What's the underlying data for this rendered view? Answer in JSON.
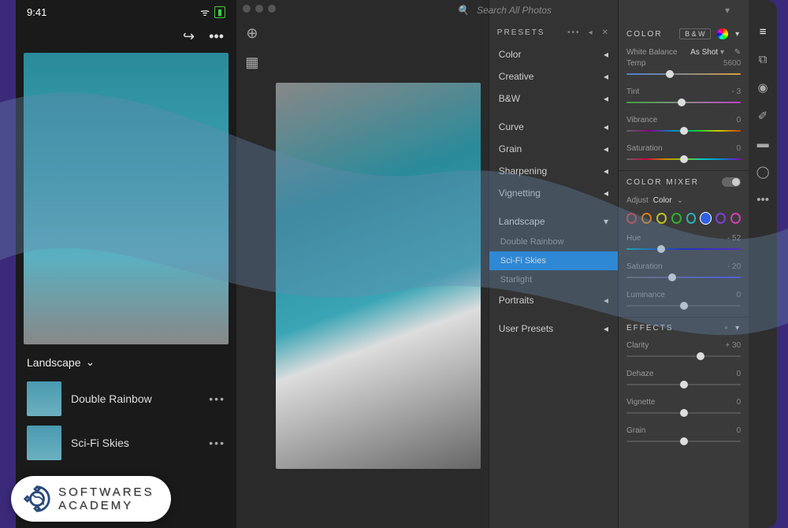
{
  "mobile": {
    "time": "9:41",
    "redo_icon": "↪",
    "more_icon": "•••",
    "category": "Landscape",
    "presets": [
      {
        "label": "Double Rainbow"
      },
      {
        "label": "Sci-Fi Skies"
      }
    ]
  },
  "search": {
    "placeholder": "Search All Photos"
  },
  "presets_panel": {
    "title": "PRESETS",
    "groups": [
      {
        "label": "Color",
        "expanded": false
      },
      {
        "label": "Creative",
        "expanded": false
      },
      {
        "label": "B&W",
        "expanded": false
      }
    ],
    "groups2": [
      {
        "label": "Curve",
        "expanded": false
      },
      {
        "label": "Grain",
        "expanded": false
      },
      {
        "label": "Sharpening",
        "expanded": false
      },
      {
        "label": "Vignetting",
        "expanded": false
      }
    ],
    "landscape": {
      "label": "Landscape",
      "items": [
        {
          "label": "Double Rainbow",
          "selected": false
        },
        {
          "label": "Sci-Fi Skies",
          "selected": true
        },
        {
          "label": "Starlight",
          "selected": false
        }
      ]
    },
    "portraits": {
      "label": "Portraits"
    },
    "user": {
      "label": "User Presets"
    }
  },
  "color_panel": {
    "title": "COLOR",
    "bw_tag": "B & W",
    "white_balance_label": "White Balance",
    "white_balance_value": "As Shot",
    "sliders": [
      {
        "name": "Temp",
        "value": "5600",
        "pos": 38,
        "track": "temp"
      },
      {
        "name": "Tint",
        "value": "- 3",
        "pos": 48,
        "track": "tint"
      },
      {
        "name": "Vibrance",
        "value": "0",
        "pos": 50,
        "track": "vib"
      },
      {
        "name": "Saturation",
        "value": "0",
        "pos": 50,
        "track": "sat"
      }
    ]
  },
  "mixer_panel": {
    "title": "COLOR MIXER",
    "adjust_label": "Adjust",
    "adjust_value": "Color",
    "colors": [
      "#d04040",
      "#d08020",
      "#c0c020",
      "#30b030",
      "#30b0b0",
      "#3060e0",
      "#8040d0",
      "#d040b0"
    ],
    "selected_color": 5,
    "sliders": [
      {
        "name": "Hue",
        "value": "- 52",
        "pos": 30,
        "track": "hue"
      },
      {
        "name": "Saturation",
        "value": "- 20",
        "pos": 40,
        "track": "sat2"
      },
      {
        "name": "Luminance",
        "value": "0",
        "pos": 50,
        "track": ""
      }
    ]
  },
  "effects_panel": {
    "title": "EFFECTS",
    "sliders": [
      {
        "name": "Clarity",
        "value": "+ 30",
        "pos": 65
      },
      {
        "name": "Dehaze",
        "value": "0",
        "pos": 50
      },
      {
        "name": "Vignette",
        "value": "0",
        "pos": 50
      },
      {
        "name": "Grain",
        "value": "0",
        "pos": 50
      }
    ]
  },
  "logo": {
    "line1": "SOFTWARES",
    "line2": "ACADEMY"
  }
}
